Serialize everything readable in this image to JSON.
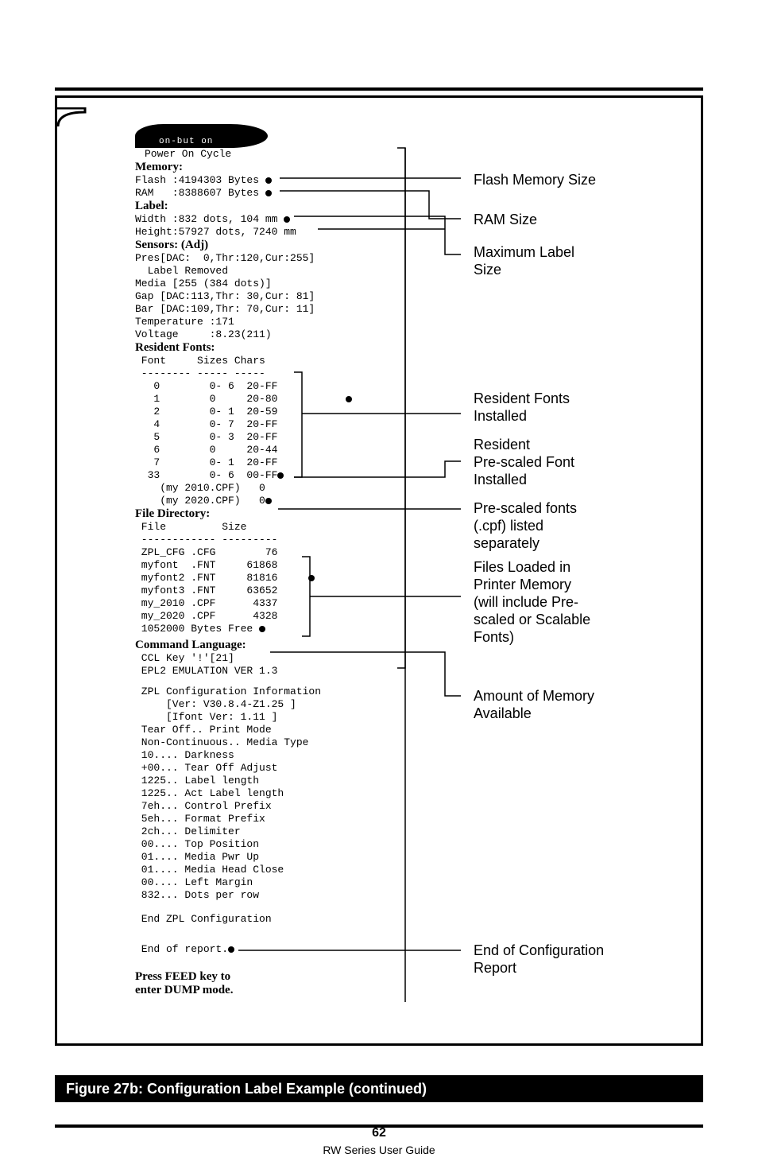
{
  "blob_text": "on-but on",
  "label": {
    "power_on": "Power On Cycle",
    "memory_head": "Memory:",
    "flash": "Flash :4194303 Bytes",
    "ram": "RAM   :8388607 Bytes",
    "label_head": "Label:",
    "width": "Width :832 dots, 104 mm",
    "height": "Height:57927 dots, 7240 mm",
    "sensors_head": "Sensors: (Adj)",
    "pres": "Pres[DAC:  0,Thr:120,Cur:255]",
    "label_removed": "  Label Removed",
    "media": "Media [255 (384 dots)]",
    "gap": "Gap [DAC:113,Thr: 30,Cur: 81]",
    "bar": "Bar [DAC:109,Thr: 70,Cur: 11]",
    "temperature": "Temperature :171",
    "voltage": "Voltage     :8.23(211)",
    "resident_head": "Resident Fonts:",
    "font_header": " Font     Sizes Chars",
    "font_sep": " -------- ----- -----",
    "font_rows": [
      "   0        0- 6  20-FF",
      "   1        0     20-80",
      "   2        0- 1  20-59",
      "   4        0- 7  20-FF",
      "   5        0- 3  20-FF",
      "   6        0     20-44",
      "   7        0- 1  20-FF",
      "  33        0- 6  00-FF",
      "    (my 2010.CPF)   0",
      "    (my 2020.CPF)   0"
    ],
    "file_dir_head": "File Directory:",
    "file_header": " File         Size",
    "file_sep": " ------------ ---------",
    "file_rows": [
      " ZPL_CFG .CFG        76",
      " myfont  .FNT     61868",
      " myfont2 .FNT     81816",
      " myfont3 .FNT     63652",
      " my_2010 .CPF      4337",
      " my_2020 .CPF      4328"
    ],
    "bytes_free": " 1052000 Bytes Free",
    "cmd_lang_head": "Command Language:",
    "ccl": " CCL Key '!'[21]",
    "epl2": " EPL2 EMULATION VER 1.3",
    "zpl_info": " ZPL Configuration Information",
    "zpl_ver": "     [Ver: V30.8.4-Z1.25 ]",
    "ifont": "     [Ifont Ver: 1.11 ]",
    "cfg_rows": [
      " Tear Off.. Print Mode",
      " Non-Continuous.. Media Type",
      " 10.... Darkness",
      " +00... Tear Off Adjust",
      " 1225.. Label length",
      " 1225.. Act Label length",
      " 7eh... Control Prefix",
      " 5eh... Format Prefix",
      " 2ch... Delimiter",
      " 00.... Top Position",
      " 01.... Media Pwr Up",
      " 01.... Media Head Close",
      " 00.... Left Margin",
      " 832... Dots per row"
    ],
    "end_zpl": " End ZPL Configuration",
    "end_report": " End of report.",
    "press_feed": "Press FEED key to",
    "enter_dump": "enter DUMP mode."
  },
  "annotations": {
    "flash_mem": "Flash Memory Size",
    "ram_size": "RAM Size",
    "max_label": "Maximum Label\nSize",
    "resident_fonts": "Resident Fonts\nInstalled",
    "prescaled_font": "Resident\nPre-scaled Font\nInstalled",
    "prescaled_listed": "Pre-scaled fonts\n(.cpf) listed\nseparately",
    "files_loaded": "Files Loaded in\nPrinter Memory\n(will include Pre-\nscaled or Scalable\nFonts)",
    "amount_mem": "Amount of Memory\nAvailable",
    "end_config": "End of Configuration\nReport"
  },
  "caption": "Figure 27b: Configuration Label Example (continued)",
  "footer": {
    "page": "62",
    "guide": "RW Series User Guide"
  }
}
